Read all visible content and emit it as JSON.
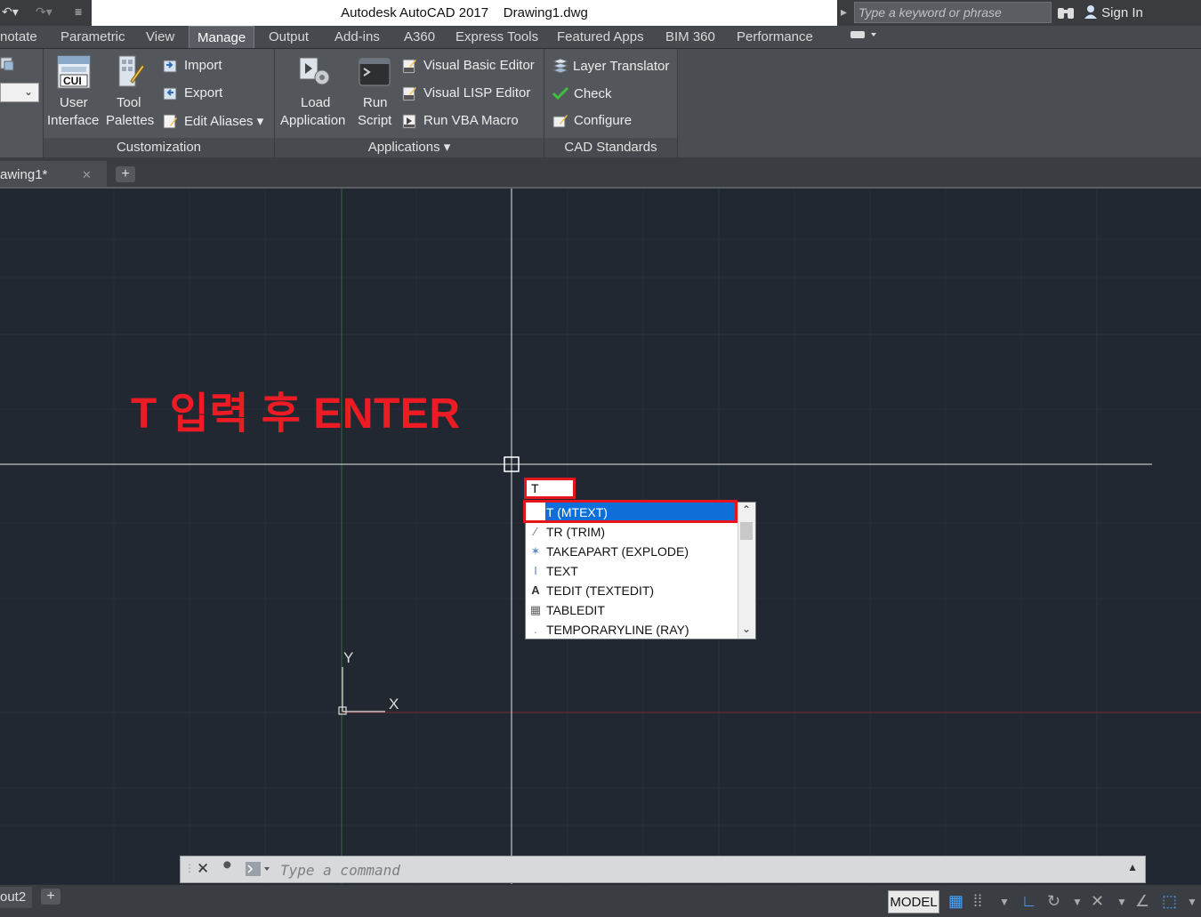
{
  "window": {
    "app_title": "Autodesk AutoCAD 2017",
    "file_title": "Drawing1.dwg",
    "search_placeholder": "Type a keyword or phrase",
    "sign_in": "Sign In"
  },
  "menu_tabs": [
    "notate",
    "Parametric",
    "View",
    "Manage",
    "Output",
    "Add-ins",
    "A360",
    "Express Tools",
    "Featured Apps",
    "BIM 360",
    "Performance"
  ],
  "active_tab": "Manage",
  "ribbon": {
    "customization": {
      "title": "Customization",
      "user_interface": [
        "User",
        "Interface"
      ],
      "tool_palettes": [
        "Tool",
        "Palettes"
      ],
      "import": "Import",
      "export": "Export",
      "edit_aliases": "Edit Aliases",
      "cui_badge": "CUI"
    },
    "applications": {
      "title": "Applications",
      "load_application": [
        "Load",
        "Application"
      ],
      "run_script": [
        "Run",
        "Script"
      ],
      "vba_editor": "Visual Basic Editor",
      "lisp_editor": "Visual LISP Editor",
      "run_vba_macro": "Run VBA Macro"
    },
    "cad_standards": {
      "title": "CAD Standards",
      "layer_translator": "Layer Translator",
      "check": "Check",
      "configure": "Configure"
    }
  },
  "doc_tab": {
    "label": "awing1*",
    "new_tab": "+"
  },
  "canvas": {
    "annotation": "T 입력 후 ENTER",
    "axis_y": "Y",
    "axis_x": "X",
    "typed_command": "T"
  },
  "autocomplete": [
    {
      "label": "T (MTEXT)",
      "icon": "mtext-icon",
      "selected": true
    },
    {
      "label": "TR (TRIM)",
      "icon": "trim-icon",
      "selected": false
    },
    {
      "label": "TAKEAPART (EXPLODE)",
      "icon": "explode-icon",
      "selected": false
    },
    {
      "label": "TEXT",
      "icon": "text-icon",
      "selected": false
    },
    {
      "label": "TEDIT (TEXTEDIT)",
      "icon": "textedit-icon",
      "selected": false
    },
    {
      "label": "TABLEDIT",
      "icon": "tabledit-icon",
      "selected": false
    },
    {
      "label": "TEMPORARYLINE (RAY)",
      "icon": "ray-icon",
      "selected": false
    }
  ],
  "command_line": {
    "placeholder": "Type a command"
  },
  "status_bar": {
    "layout_tab": "out2",
    "add_layout": "+",
    "model": "MODEL"
  },
  "colors": {
    "annotation_red": "#ed1c24",
    "selection_blue": "#0f6fd8",
    "canvas_bg": "#212831"
  }
}
